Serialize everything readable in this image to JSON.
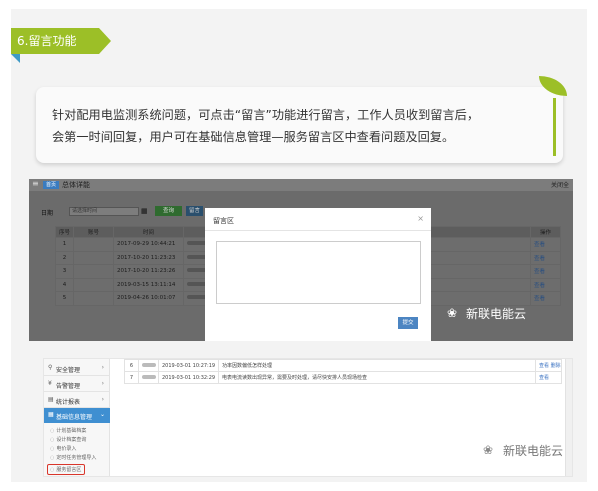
{
  "section": {
    "badge": "6.留言功能"
  },
  "callout": {
    "line1": "针对配用电监测系统问题，可点击“留言”功能进行留言，工作人员收到留言后，",
    "line2": "会第一时间回复，用户可在基础信息管理—服务留言区中查看问题及回复。"
  },
  "shot1": {
    "home_tab": "首页",
    "title": "总体详能",
    "close_all": "关闭全",
    "menu_icon": "hamburger-icon",
    "search_label": "日期",
    "search_placeholder": "请选择时间",
    "query_label": "查询",
    "more_label": "留言",
    "table": {
      "headers": [
        "序号",
        "账号",
        "时间",
        "",
        "操作"
      ],
      "rows": [
        {
          "num": "1",
          "account": "",
          "time": "2017-09-29 10:44:21",
          "action": "查看"
        },
        {
          "num": "2",
          "account": "",
          "time": "2017-10-20 11:23:23",
          "action": "查看"
        },
        {
          "num": "3",
          "account": "",
          "time": "2017-10-20 11:23:26",
          "action": "查看"
        },
        {
          "num": "4",
          "account": "",
          "time": "2019-03-15 13:11:14",
          "action": "查看"
        },
        {
          "num": "5",
          "account": "",
          "time": "2019-04-26 10:01:07",
          "action": "查看"
        }
      ]
    },
    "dialog": {
      "title": "留言区",
      "close": "×",
      "textarea_value": "",
      "ok_label": "提交"
    }
  },
  "shot2": {
    "menu": [
      {
        "label": "安全管理",
        "icon": "shield-icon"
      },
      {
        "label": "告警管理",
        "icon": "alarm-icon"
      },
      {
        "label": "统计报表",
        "icon": "chart-icon"
      }
    ],
    "active_menu": "基础信息管理",
    "submenu": [
      "计划基础档案",
      "设计档案查询",
      "电价录入",
      "定时任务管理导入",
      "服务留言区"
    ],
    "rows": [
      {
        "num": "6",
        "time": "2019-03-01 10:27:19",
        "message": "功率因数偏低怎样处理",
        "actions": "查看 删除"
      },
      {
        "num": "7",
        "time": "2019-03-01 10:32:29",
        "message": "电表电流读数出现异常，需要及时处理，请尽快安排人员现场检查",
        "actions": "查看"
      }
    ]
  },
  "watermark": "新联电能云"
}
